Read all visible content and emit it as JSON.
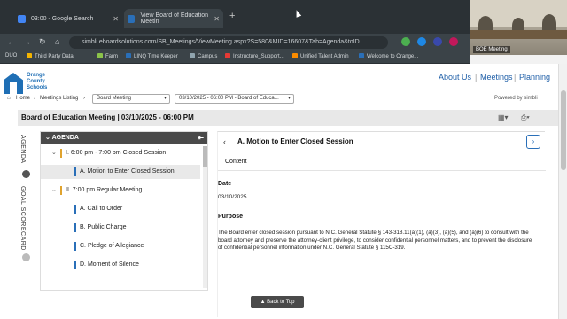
{
  "browser": {
    "tabs": [
      {
        "label": "03:00 - Google Search",
        "color": "#4285f4"
      },
      {
        "label": "View Board of Education Meetin",
        "color": "#2a6fb8"
      }
    ],
    "url": "simbli.eboardsolutions.com/SB_Meetings/ViewMeeting.aspx?S=580&MID=16607&Tab=Agenda&toID...",
    "bookmarks": [
      "DUO",
      "Third Party Data",
      "Farm",
      "LINQ Time Keeper",
      "Campus",
      "Instructure_Support...",
      "Unified Talent Admin",
      "Welcome to Orange..."
    ]
  },
  "camera": {
    "label": "BOE Meeting"
  },
  "site": {
    "logo": {
      "line1": "Orange",
      "line2": "County",
      "line3": "Schools"
    },
    "nav": [
      "About Us",
      "Meetings",
      "Planning"
    ],
    "accent": "#1f5fa8"
  },
  "breadcrumb": {
    "home": "Home",
    "listing": "Meetings Listing",
    "meeting_type": "Board Meeting",
    "meeting_select": "03/10/2025 - 06:00 PM - Board of Educa...",
    "powered_by": "Powered by simbli"
  },
  "meeting": {
    "title": "Board of Education Meeting | 03/10/2025 - 06:00 PM"
  },
  "sidebar": {
    "tab_agenda": "AGENDA",
    "tab_scorecard": "GOAL SCORECARD"
  },
  "agenda": {
    "header": "AGENDA",
    "items": [
      {
        "text": "I. 6:00 pm - 7:00 pm Closed Session",
        "level": 0,
        "bar": "#e0a32e"
      },
      {
        "text": "A. Motion to Enter Closed Session",
        "level": 1,
        "bar": "#2a6fb8",
        "active": true
      },
      {
        "text": "II. 7:00 pm Regular Meeting",
        "level": 0,
        "bar": "#e0a32e"
      },
      {
        "text": "A. Call to Order",
        "level": 1,
        "bar": "#2a6fb8"
      },
      {
        "text": "B. Public Charge",
        "level": 1,
        "bar": "#2a6fb8"
      },
      {
        "text": "C. Pledge of Allegiance",
        "level": 1,
        "bar": "#2a6fb8"
      },
      {
        "text": "D. Moment of Silence",
        "level": 1,
        "bar": "#2a6fb8"
      }
    ]
  },
  "detail": {
    "title": "A. Motion to Enter Closed Session",
    "tab": "Content",
    "date_label": "Date",
    "date_value": "03/10/2025",
    "purpose_label": "Purpose",
    "purpose_text": "The Board enter closed session pursuant to N.C. General Statute § 143-318.11(a)(1), (a)(3), (a)(5), and (a)(6) to consult with the board attorney and preserve the attorney-client privilege, to consider confidential personnel matters, and to prevent the disclosure of confidential personnel information under N.C. General Statute § 115C-319."
  },
  "back_to_top": "Back to Top"
}
